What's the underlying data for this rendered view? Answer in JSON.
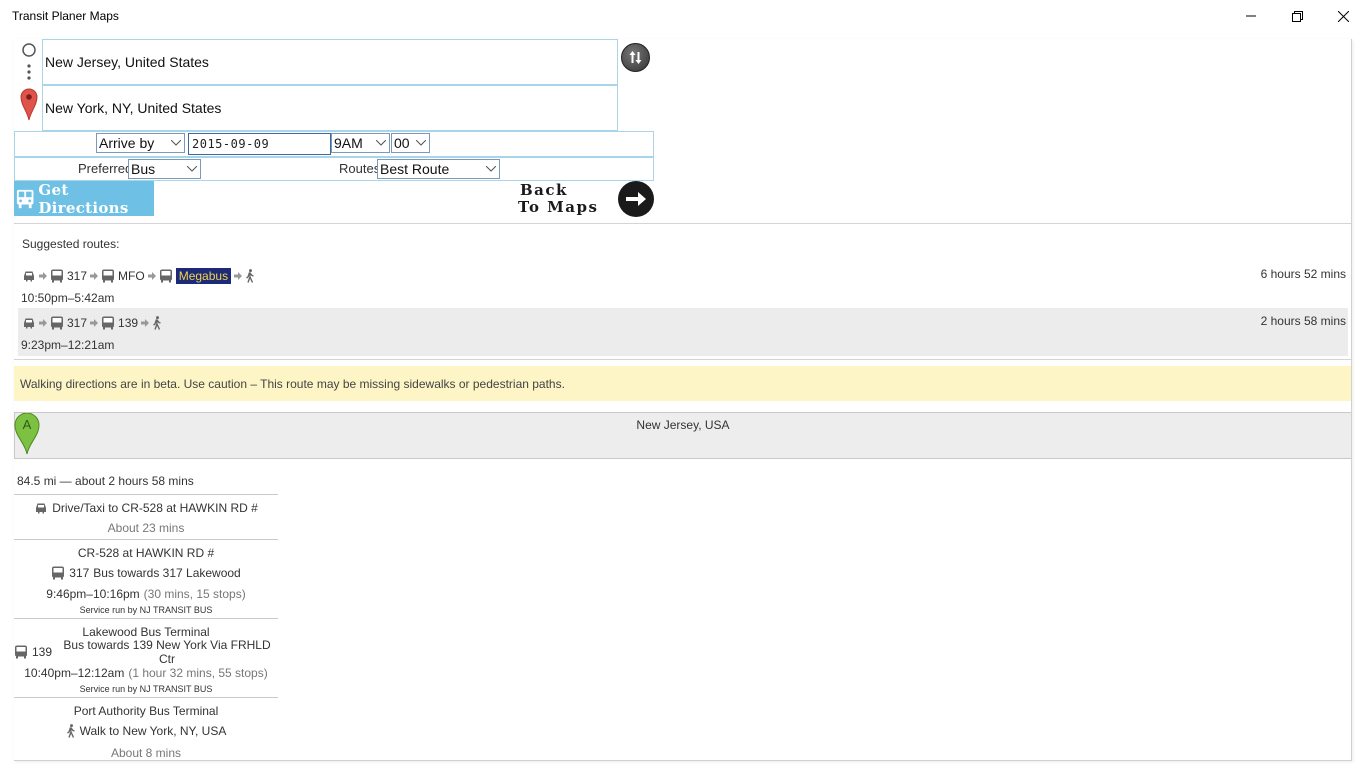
{
  "window": {
    "title": "Transit Planer Maps"
  },
  "search": {
    "origin": "New Jersey, United States",
    "destination": "New York, NY, United States"
  },
  "options": {
    "time_mode": "Arrive by",
    "date": "2015-09-09",
    "hour": "9AM",
    "minute": "00",
    "preferred_label": "Preferred",
    "preferred_value": "Bus",
    "routes_label": "Routes",
    "routes_value": "Best Route"
  },
  "buttons": {
    "get_directions": "Get Directions",
    "back_line1": "Back",
    "back_line2": "To Maps"
  },
  "routes": {
    "title": "Suggested routes:",
    "items": [
      {
        "leg_317": "317",
        "leg_mfo": "MFO",
        "leg_agency": "Megabus",
        "time": "10:50pm–5:42am",
        "duration": "6 hours 52 mins"
      },
      {
        "leg_317": "317",
        "leg_139": "139",
        "time": "9:23pm–12:21am",
        "duration": "2 hours 58 mins"
      }
    ]
  },
  "warning": "Walking directions are in beta. Use caution – This route may be missing sidewalks or pedestrian paths.",
  "start": {
    "marker": "A",
    "location": "New Jersey, USA"
  },
  "summary": "84.5 mi — about 2 hours 58 mins",
  "steps": {
    "s1_text": "Drive/Taxi to CR-528 at HAWKIN RD #",
    "s1_sub": "About 23 mins",
    "s2_stop": "CR-528 at HAWKIN RD #",
    "s2_route": "317",
    "s2_text": "Bus towards 317 Lakewood",
    "s2_time": "9:46pm–10:16pm",
    "s2_extra": "(30 mins, 15 stops)",
    "s2_service": "Service run by NJ TRANSIT BUS",
    "s3_stop": "Lakewood Bus Terminal",
    "s3_route": "139",
    "s3_text": "Bus towards 139 New York Via FRHLD Ctr",
    "s3_time": "10:40pm–12:12am",
    "s3_extra": "(1 hour 32 mins, 55 stops)",
    "s3_service": "Service run by NJ TRANSIT BUS",
    "s4_stop": "Port Authority Bus Terminal",
    "s4_text": "Walk to New York, NY, USA",
    "s4_sub": "About 8 mins"
  },
  "colors": {
    "accent": "#6ec1e4",
    "field_border": "#a9d4ea",
    "warning_bg": "#fdf5c5",
    "agency_bg": "#1d2a78",
    "agency_text": "#f2d34a",
    "marker_red": "#e0534a",
    "marker_green": "#7cc142"
  }
}
